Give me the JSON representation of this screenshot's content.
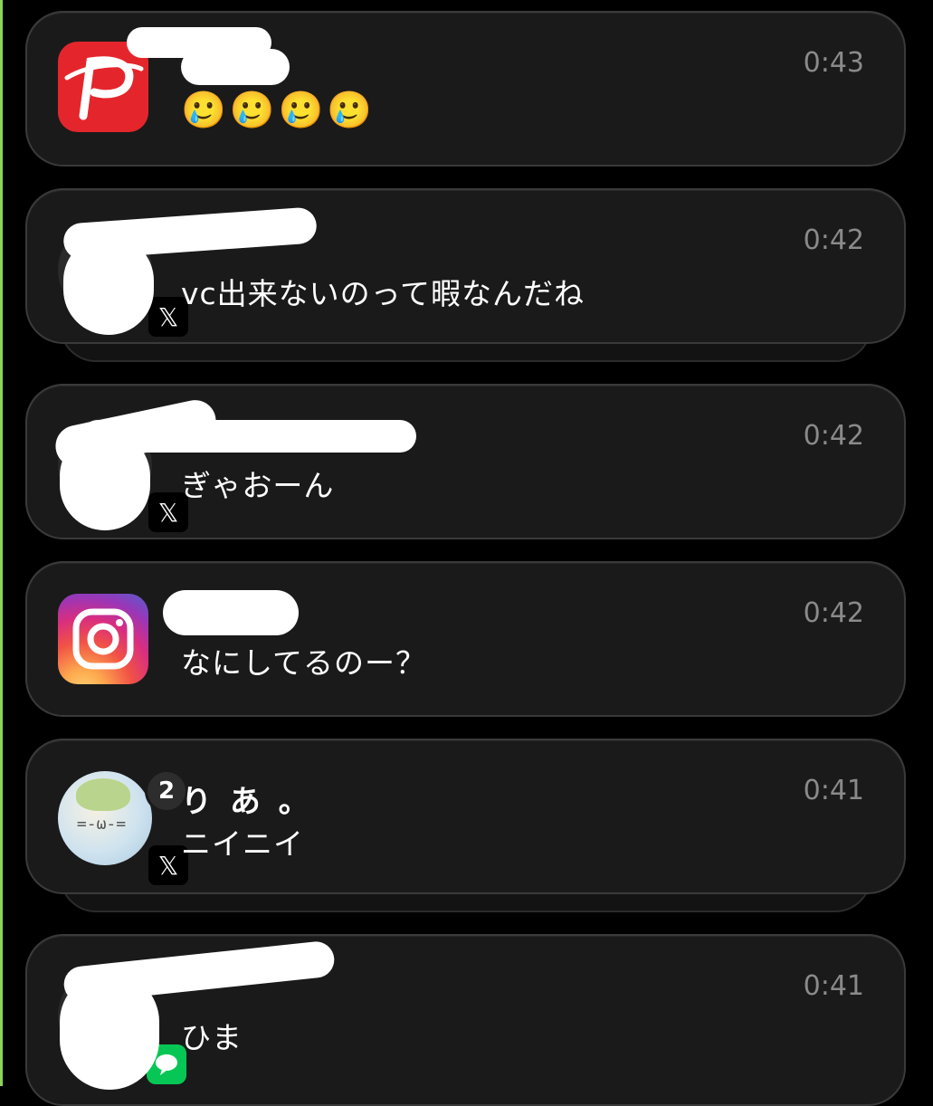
{
  "notifications": [
    {
      "app": "PayPay",
      "icon": "paypay-icon",
      "title": "",
      "body": "🥲🥲🥲🥲",
      "time": "0:43",
      "accent": "#e4262c"
    },
    {
      "app": "X",
      "icon": "x-icon",
      "title": "",
      "body": "vc出来ないのって暇なんだね",
      "time": "0:42"
    },
    {
      "app": "X",
      "icon": "x-icon",
      "title": "",
      "body": "ぎゃおーん",
      "time": "0:42"
    },
    {
      "app": "Instagram",
      "icon": "instagram-icon",
      "title": "",
      "body": "なにしてるのー？",
      "time": "0:42"
    },
    {
      "app": "X",
      "icon": "x-icon",
      "title": "り あ 。",
      "body": "ニイニイ",
      "time": "0:41",
      "badge_count": "2",
      "avatar_face": "=-ω-="
    },
    {
      "app": "LINE",
      "icon": "line-icon",
      "title": "",
      "body": "ひま",
      "time": "0:41",
      "accent": "#06c755"
    }
  ],
  "x_glyph": "𝕏"
}
